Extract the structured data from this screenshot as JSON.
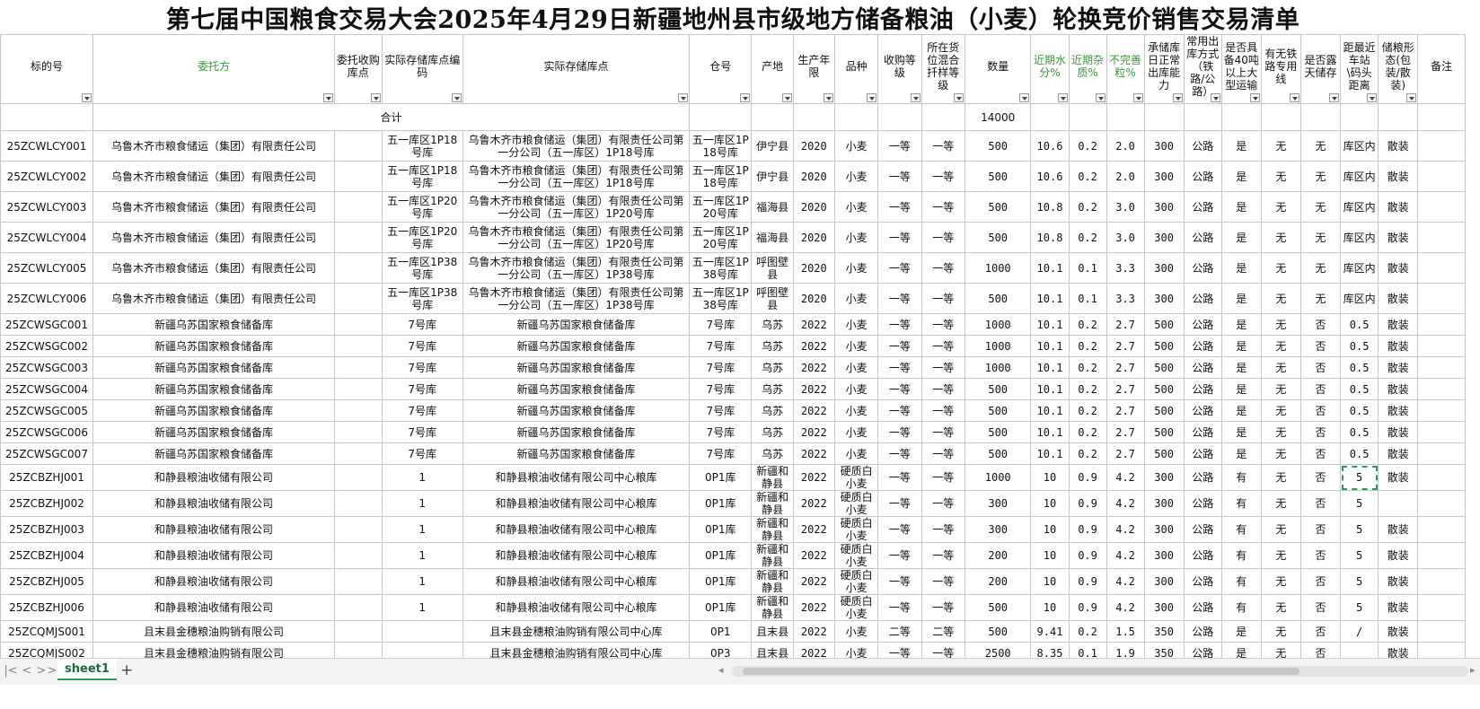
{
  "title": "第七届中国粮食交易大会2025年4月29日新疆地州县市级地方储备粮油（小麦）轮换竞价销售交易清单",
  "headers": [
    {
      "label": "标的号",
      "green": false
    },
    {
      "label": "委托方",
      "green": true
    },
    {
      "label": "委托收购库点",
      "green": false
    },
    {
      "label": "实际存储库点编码",
      "green": false
    },
    {
      "label": "实际存储库点",
      "green": false
    },
    {
      "label": "仓号",
      "green": false
    },
    {
      "label": "产地",
      "green": false
    },
    {
      "label": "生产年限",
      "green": false
    },
    {
      "label": "品种",
      "green": false
    },
    {
      "label": "收购等级",
      "green": false
    },
    {
      "label": "所在货位混合扦样等级",
      "green": false
    },
    {
      "label": "数量",
      "green": false
    },
    {
      "label": "近期水分%",
      "green": true
    },
    {
      "label": "近期杂质%",
      "green": true
    },
    {
      "label": "不完善粒%",
      "green": true
    },
    {
      "label": "承储库日正常出库能力",
      "green": false
    },
    {
      "label": "常用出库方式（铁路/公路）",
      "green": false
    },
    {
      "label": "是否具备40吨以上大型运输",
      "green": false
    },
    {
      "label": "有无铁路专用线",
      "green": false
    },
    {
      "label": "是否露天储存",
      "green": false
    },
    {
      "label": "距最近车站\\码头距离",
      "green": false
    },
    {
      "label": "储粮形态(包装/散装)",
      "green": false
    },
    {
      "label": "备注",
      "green": false
    }
  ],
  "total_row": {
    "label": "合计",
    "quantity": "14000"
  },
  "rows": [
    {
      "cls": "row-tall",
      "c": [
        "25ZCWLCY001",
        "乌鲁木齐市粮食储运（集团）有限责任公司",
        "",
        "五一库区1P18号库",
        "乌鲁木齐市粮食储运（集团）有限责任公司第一分公司（五一库区）1P18号库",
        "五一库区1P18号库",
        "伊宁县",
        "2020",
        "小麦",
        "一等",
        "一等",
        "500",
        "10.6",
        "0.2",
        "2.0",
        "300",
        "公路",
        "是",
        "无",
        "无",
        "库区内",
        "散装",
        ""
      ]
    },
    {
      "cls": "row-tall",
      "c": [
        "25ZCWLCY002",
        "乌鲁木齐市粮食储运（集团）有限责任公司",
        "",
        "五一库区1P18号库",
        "乌鲁木齐市粮食储运（集团）有限责任公司第一分公司（五一库区）1P18号库",
        "五一库区1P18号库",
        "伊宁县",
        "2020",
        "小麦",
        "一等",
        "一等",
        "500",
        "10.6",
        "0.2",
        "2.0",
        "300",
        "公路",
        "是",
        "无",
        "无",
        "库区内",
        "散装",
        ""
      ]
    },
    {
      "cls": "row-tall",
      "c": [
        "25ZCWLCY003",
        "乌鲁木齐市粮食储运（集团）有限责任公司",
        "",
        "五一库区1P20号库",
        "乌鲁木齐市粮食储运（集团）有限责任公司第一分公司（五一库区）1P20号库",
        "五一库区1P20号库",
        "福海县",
        "2020",
        "小麦",
        "一等",
        "一等",
        "500",
        "10.8",
        "0.2",
        "3.0",
        "300",
        "公路",
        "是",
        "无",
        "无",
        "库区内",
        "散装",
        ""
      ]
    },
    {
      "cls": "row-tall",
      "c": [
        "25ZCWLCY004",
        "乌鲁木齐市粮食储运（集团）有限责任公司",
        "",
        "五一库区1P20号库",
        "乌鲁木齐市粮食储运（集团）有限责任公司第一分公司（五一库区）1P20号库",
        "五一库区1P20号库",
        "福海县",
        "2020",
        "小麦",
        "一等",
        "一等",
        "500",
        "10.8",
        "0.2",
        "3.0",
        "300",
        "公路",
        "是",
        "无",
        "无",
        "库区内",
        "散装",
        ""
      ]
    },
    {
      "cls": "row-tall",
      "c": [
        "25ZCWLCY005",
        "乌鲁木齐市粮食储运（集团）有限责任公司",
        "",
        "五一库区1P38号库",
        "乌鲁木齐市粮食储运（集团）有限责任公司第一分公司（五一库区）1P38号库",
        "五一库区1P38号库",
        "呼图壁县",
        "2020",
        "小麦",
        "一等",
        "一等",
        "1000",
        "10.1",
        "0.1",
        "3.3",
        "300",
        "公路",
        "是",
        "无",
        "无",
        "库区内",
        "散装",
        ""
      ]
    },
    {
      "cls": "row-tall",
      "c": [
        "25ZCWLCY006",
        "乌鲁木齐市粮食储运（集团）有限责任公司",
        "",
        "五一库区1P38号库",
        "乌鲁木齐市粮食储运（集团）有限责任公司第一分公司（五一库区）1P38号库",
        "五一库区1P38号库",
        "呼图壁县",
        "2020",
        "小麦",
        "一等",
        "一等",
        "500",
        "10.1",
        "0.1",
        "3.3",
        "300",
        "公路",
        "是",
        "无",
        "无",
        "库区内",
        "散装",
        ""
      ]
    },
    {
      "cls": "row-mid",
      "c": [
        "25ZCWSGC001",
        "新疆乌苏国家粮食储备库",
        "",
        "7号库",
        "新疆乌苏国家粮食储备库",
        "7号库",
        "乌苏",
        "2022",
        "小麦",
        "一等",
        "一等",
        "1000",
        "10.1",
        "0.2",
        "2.7",
        "500",
        "公路",
        "是",
        "无",
        "否",
        "0.5",
        "散装",
        ""
      ]
    },
    {
      "cls": "row-mid",
      "c": [
        "25ZCWSGC002",
        "新疆乌苏国家粮食储备库",
        "",
        "7号库",
        "新疆乌苏国家粮食储备库",
        "7号库",
        "乌苏",
        "2022",
        "小麦",
        "一等",
        "一等",
        "1000",
        "10.1",
        "0.2",
        "2.7",
        "500",
        "公路",
        "是",
        "无",
        "否",
        "0.5",
        "散装",
        ""
      ]
    },
    {
      "cls": "row-mid",
      "c": [
        "25ZCWSGC003",
        "新疆乌苏国家粮食储备库",
        "",
        "7号库",
        "新疆乌苏国家粮食储备库",
        "7号库",
        "乌苏",
        "2022",
        "小麦",
        "一等",
        "一等",
        "1000",
        "10.1",
        "0.2",
        "2.7",
        "500",
        "公路",
        "是",
        "无",
        "否",
        "0.5",
        "散装",
        ""
      ]
    },
    {
      "cls": "row-mid",
      "c": [
        "25ZCWSGC004",
        "新疆乌苏国家粮食储备库",
        "",
        "7号库",
        "新疆乌苏国家粮食储备库",
        "7号库",
        "乌苏",
        "2022",
        "小麦",
        "一等",
        "一等",
        "500",
        "10.1",
        "0.2",
        "2.7",
        "500",
        "公路",
        "是",
        "无",
        "否",
        "0.5",
        "散装",
        ""
      ]
    },
    {
      "cls": "row-mid",
      "c": [
        "25ZCWSGC005",
        "新疆乌苏国家粮食储备库",
        "",
        "7号库",
        "新疆乌苏国家粮食储备库",
        "7号库",
        "乌苏",
        "2022",
        "小麦",
        "一等",
        "一等",
        "500",
        "10.1",
        "0.2",
        "2.7",
        "500",
        "公路",
        "是",
        "无",
        "否",
        "0.5",
        "散装",
        ""
      ]
    },
    {
      "cls": "row-mid",
      "c": [
        "25ZCWSGC006",
        "新疆乌苏国家粮食储备库",
        "",
        "7号库",
        "新疆乌苏国家粮食储备库",
        "7号库",
        "乌苏",
        "2022",
        "小麦",
        "一等",
        "一等",
        "500",
        "10.1",
        "0.2",
        "2.7",
        "500",
        "公路",
        "是",
        "无",
        "否",
        "0.5",
        "散装",
        ""
      ]
    },
    {
      "cls": "row-mid",
      "c": [
        "25ZCWSGC007",
        "新疆乌苏国家粮食储备库",
        "",
        "7号库",
        "新疆乌苏国家粮食储备库",
        "7号库",
        "乌苏",
        "2022",
        "小麦",
        "一等",
        "一等",
        "500",
        "10.1",
        "0.2",
        "2.7",
        "500",
        "公路",
        "是",
        "无",
        "否",
        "0.5",
        "散装",
        ""
      ]
    },
    {
      "cls": "row-bzhj",
      "sel": 20,
      "c": [
        "25ZCBZHJ001",
        "和静县粮油收储有限公司",
        "",
        "1",
        "和静县粮油收储有限公司中心粮库",
        "0P1库",
        "新疆和静县",
        "2022",
        "硬质白小麦",
        "一等",
        "一等",
        "1000",
        "10",
        "0.9",
        "4.2",
        "300",
        "公路",
        "有",
        "无",
        "否",
        "5",
        "散装",
        ""
      ]
    },
    {
      "cls": "row-bzhj",
      "c": [
        "25ZCBZHJ002",
        "和静县粮油收储有限公司",
        "",
        "1",
        "和静县粮油收储有限公司中心粮库",
        "0P1库",
        "新疆和静县",
        "2022",
        "硬质白小麦",
        "一等",
        "一等",
        "300",
        "10",
        "0.9",
        "4.2",
        "300",
        "公路",
        "有",
        "无",
        "否",
        "5",
        "",
        ""
      ]
    },
    {
      "cls": "row-bzhj",
      "c": [
        "25ZCBZHJ003",
        "和静县粮油收储有限公司",
        "",
        "1",
        "和静县粮油收储有限公司中心粮库",
        "0P1库",
        "新疆和静县",
        "2022",
        "硬质白小麦",
        "一等",
        "一等",
        "300",
        "10",
        "0.9",
        "4.2",
        "300",
        "公路",
        "有",
        "无",
        "否",
        "5",
        "散装",
        ""
      ]
    },
    {
      "cls": "row-bzhj",
      "c": [
        "25ZCBZHJ004",
        "和静县粮油收储有限公司",
        "",
        "1",
        "和静县粮油收储有限公司中心粮库",
        "0P1库",
        "新疆和静县",
        "2022",
        "硬质白小麦",
        "一等",
        "一等",
        "200",
        "10",
        "0.9",
        "4.2",
        "300",
        "公路",
        "有",
        "无",
        "否",
        "5",
        "散装",
        ""
      ]
    },
    {
      "cls": "row-bzhj",
      "c": [
        "25ZCBZHJ005",
        "和静县粮油收储有限公司",
        "",
        "1",
        "和静县粮油收储有限公司中心粮库",
        "0P1库",
        "新疆和静县",
        "2022",
        "硬质白小麦",
        "一等",
        "一等",
        "200",
        "10",
        "0.9",
        "4.2",
        "300",
        "公路",
        "有",
        "无",
        "否",
        "5",
        "散装",
        ""
      ]
    },
    {
      "cls": "row-bzhj",
      "c": [
        "25ZCBZHJ006",
        "和静县粮油收储有限公司",
        "",
        "1",
        "和静县粮油收储有限公司中心粮库",
        "0P1库",
        "新疆和静县",
        "2022",
        "硬质白小麦",
        "一等",
        "一等",
        "500",
        "10",
        "0.9",
        "4.2",
        "300",
        "公路",
        "有",
        "无",
        "否",
        "5",
        "散装",
        ""
      ]
    },
    {
      "cls": "row-last",
      "c": [
        "25ZCQMJS001",
        "且末县金穗粮油购销有限公司",
        "",
        "",
        "且末县金穗粮油购销有限公司中心库",
        "0P1",
        "且末县",
        "2022",
        "小麦",
        "二等",
        "二等",
        "500",
        "9.41",
        "0.2",
        "1.5",
        "350",
        "公路",
        "是",
        "无",
        "否",
        "/",
        "散装",
        ""
      ]
    },
    {
      "cls": "row-last",
      "c": [
        "25ZCQMJS002",
        "且末县金穗粮油购销有限公司",
        "",
        "",
        "且末县金穗粮油购销有限公司中心库",
        "0P3",
        "且末县",
        "2022",
        "小麦",
        "一等",
        "一等",
        "2500",
        "8.35",
        "0.1",
        "1.9",
        "350",
        "公路",
        "是",
        "无",
        "否",
        "",
        "散装",
        ""
      ]
    }
  ],
  "bottom_bar": {
    "sheet_tab": "sheet1",
    "add_sheet": "+",
    "nav_first": "|<",
    "nav_prev": "<",
    "nav_next": ">",
    "nav_last": ">|"
  },
  "colors": {
    "accent": "#2e9a5a",
    "header_green": "#3a9a3a"
  }
}
